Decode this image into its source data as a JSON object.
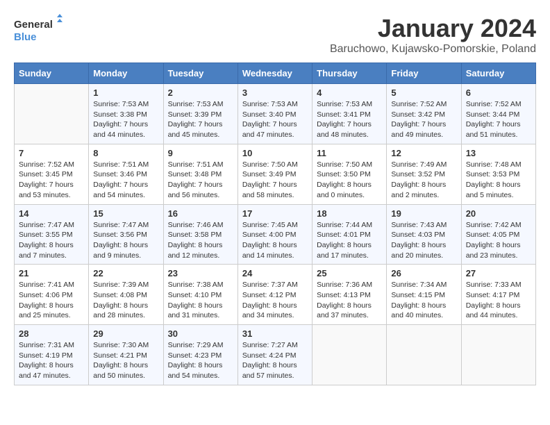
{
  "header": {
    "logo_line1": "General",
    "logo_line2": "Blue",
    "month": "January 2024",
    "location": "Baruchowo, Kujawsko-Pomorskie, Poland"
  },
  "days_of_week": [
    "Sunday",
    "Monday",
    "Tuesday",
    "Wednesday",
    "Thursday",
    "Friday",
    "Saturday"
  ],
  "weeks": [
    [
      {
        "day": "",
        "info": ""
      },
      {
        "day": "1",
        "info": "Sunrise: 7:53 AM\nSunset: 3:38 PM\nDaylight: 7 hours\nand 44 minutes."
      },
      {
        "day": "2",
        "info": "Sunrise: 7:53 AM\nSunset: 3:39 PM\nDaylight: 7 hours\nand 45 minutes."
      },
      {
        "day": "3",
        "info": "Sunrise: 7:53 AM\nSunset: 3:40 PM\nDaylight: 7 hours\nand 47 minutes."
      },
      {
        "day": "4",
        "info": "Sunrise: 7:53 AM\nSunset: 3:41 PM\nDaylight: 7 hours\nand 48 minutes."
      },
      {
        "day": "5",
        "info": "Sunrise: 7:52 AM\nSunset: 3:42 PM\nDaylight: 7 hours\nand 49 minutes."
      },
      {
        "day": "6",
        "info": "Sunrise: 7:52 AM\nSunset: 3:44 PM\nDaylight: 7 hours\nand 51 minutes."
      }
    ],
    [
      {
        "day": "7",
        "info": "Sunrise: 7:52 AM\nSunset: 3:45 PM\nDaylight: 7 hours\nand 53 minutes."
      },
      {
        "day": "8",
        "info": "Sunrise: 7:51 AM\nSunset: 3:46 PM\nDaylight: 7 hours\nand 54 minutes."
      },
      {
        "day": "9",
        "info": "Sunrise: 7:51 AM\nSunset: 3:48 PM\nDaylight: 7 hours\nand 56 minutes."
      },
      {
        "day": "10",
        "info": "Sunrise: 7:50 AM\nSunset: 3:49 PM\nDaylight: 7 hours\nand 58 minutes."
      },
      {
        "day": "11",
        "info": "Sunrise: 7:50 AM\nSunset: 3:50 PM\nDaylight: 8 hours\nand 0 minutes."
      },
      {
        "day": "12",
        "info": "Sunrise: 7:49 AM\nSunset: 3:52 PM\nDaylight: 8 hours\nand 2 minutes."
      },
      {
        "day": "13",
        "info": "Sunrise: 7:48 AM\nSunset: 3:53 PM\nDaylight: 8 hours\nand 5 minutes."
      }
    ],
    [
      {
        "day": "14",
        "info": "Sunrise: 7:47 AM\nSunset: 3:55 PM\nDaylight: 8 hours\nand 7 minutes."
      },
      {
        "day": "15",
        "info": "Sunrise: 7:47 AM\nSunset: 3:56 PM\nDaylight: 8 hours\nand 9 minutes."
      },
      {
        "day": "16",
        "info": "Sunrise: 7:46 AM\nSunset: 3:58 PM\nDaylight: 8 hours\nand 12 minutes."
      },
      {
        "day": "17",
        "info": "Sunrise: 7:45 AM\nSunset: 4:00 PM\nDaylight: 8 hours\nand 14 minutes."
      },
      {
        "day": "18",
        "info": "Sunrise: 7:44 AM\nSunset: 4:01 PM\nDaylight: 8 hours\nand 17 minutes."
      },
      {
        "day": "19",
        "info": "Sunrise: 7:43 AM\nSunset: 4:03 PM\nDaylight: 8 hours\nand 20 minutes."
      },
      {
        "day": "20",
        "info": "Sunrise: 7:42 AM\nSunset: 4:05 PM\nDaylight: 8 hours\nand 23 minutes."
      }
    ],
    [
      {
        "day": "21",
        "info": "Sunrise: 7:41 AM\nSunset: 4:06 PM\nDaylight: 8 hours\nand 25 minutes."
      },
      {
        "day": "22",
        "info": "Sunrise: 7:39 AM\nSunset: 4:08 PM\nDaylight: 8 hours\nand 28 minutes."
      },
      {
        "day": "23",
        "info": "Sunrise: 7:38 AM\nSunset: 4:10 PM\nDaylight: 8 hours\nand 31 minutes."
      },
      {
        "day": "24",
        "info": "Sunrise: 7:37 AM\nSunset: 4:12 PM\nDaylight: 8 hours\nand 34 minutes."
      },
      {
        "day": "25",
        "info": "Sunrise: 7:36 AM\nSunset: 4:13 PM\nDaylight: 8 hours\nand 37 minutes."
      },
      {
        "day": "26",
        "info": "Sunrise: 7:34 AM\nSunset: 4:15 PM\nDaylight: 8 hours\nand 40 minutes."
      },
      {
        "day": "27",
        "info": "Sunrise: 7:33 AM\nSunset: 4:17 PM\nDaylight: 8 hours\nand 44 minutes."
      }
    ],
    [
      {
        "day": "28",
        "info": "Sunrise: 7:31 AM\nSunset: 4:19 PM\nDaylight: 8 hours\nand 47 minutes."
      },
      {
        "day": "29",
        "info": "Sunrise: 7:30 AM\nSunset: 4:21 PM\nDaylight: 8 hours\nand 50 minutes."
      },
      {
        "day": "30",
        "info": "Sunrise: 7:29 AM\nSunset: 4:23 PM\nDaylight: 8 hours\nand 54 minutes."
      },
      {
        "day": "31",
        "info": "Sunrise: 7:27 AM\nSunset: 4:24 PM\nDaylight: 8 hours\nand 57 minutes."
      },
      {
        "day": "",
        "info": ""
      },
      {
        "day": "",
        "info": ""
      },
      {
        "day": "",
        "info": ""
      }
    ]
  ]
}
